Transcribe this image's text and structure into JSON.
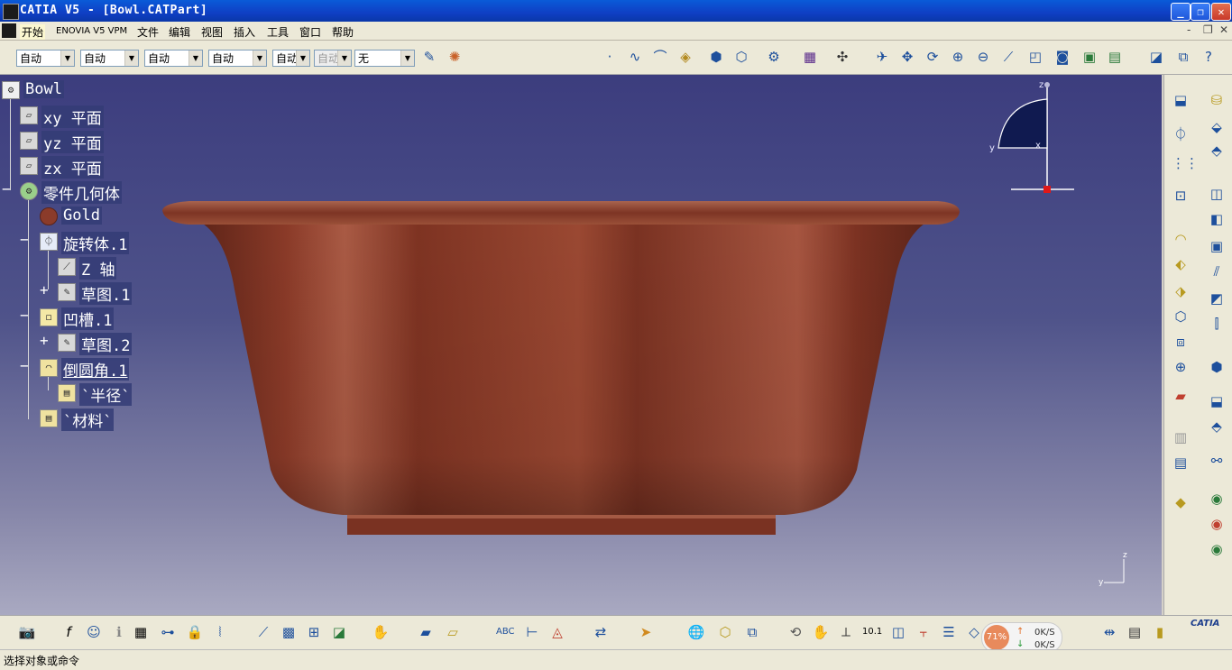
{
  "window": {
    "title": "CATIA V5 - [Bowl.CATPart]",
    "buttons": {
      "minimize": "_",
      "restore": "❐",
      "close": "✕"
    },
    "mdi_buttons": {
      "minimize": "-",
      "restore": "❐",
      "close": "✕"
    }
  },
  "menu": {
    "items": [
      "开始",
      "ENOVIA V5 VPM",
      "文件",
      "编辑",
      "视图",
      "插入",
      "工具",
      "窗口",
      "帮助"
    ]
  },
  "toolbar": {
    "combos": [
      {
        "value": "自动",
        "enabled": true
      },
      {
        "value": "自动",
        "enabled": true
      },
      {
        "value": "自动",
        "enabled": true
      },
      {
        "value": "自动",
        "enabled": true
      },
      {
        "value": "自动",
        "enabled": true
      },
      {
        "value": "自动",
        "enabled": false
      },
      {
        "value": "无",
        "enabled": true
      }
    ]
  },
  "tree": {
    "root": "Bowl",
    "nodes": [
      {
        "label": "xy 平面"
      },
      {
        "label": "yz 平面"
      },
      {
        "label": "zx 平面"
      },
      {
        "label": "零件几何体"
      },
      {
        "label": "Gold"
      },
      {
        "label": "旋转体.1"
      },
      {
        "label": "Z 轴"
      },
      {
        "label": "草图.1"
      },
      {
        "label": "凹槽.1"
      },
      {
        "label": "草图.2"
      },
      {
        "label": "倒圆角.1"
      },
      {
        "label": "`半径`"
      },
      {
        "label": "`材料`"
      }
    ]
  },
  "compass": {
    "axis_y": "y",
    "axis_x": "x",
    "axis_z": "z"
  },
  "mini_axis": {
    "z": "z",
    "y": "y"
  },
  "perf_monitor": {
    "percent": "71%",
    "upload": "0K/S",
    "download": "0K/S"
  },
  "status": {
    "text": "选择对象或命令"
  },
  "logo": {
    "text": "CATIA"
  },
  "colors": {
    "viewport_top": "#3c3d7e",
    "viewport_bottom": "#a9a9c1",
    "bowl": "#7d3424",
    "titlebar": "#0f3fc4"
  }
}
